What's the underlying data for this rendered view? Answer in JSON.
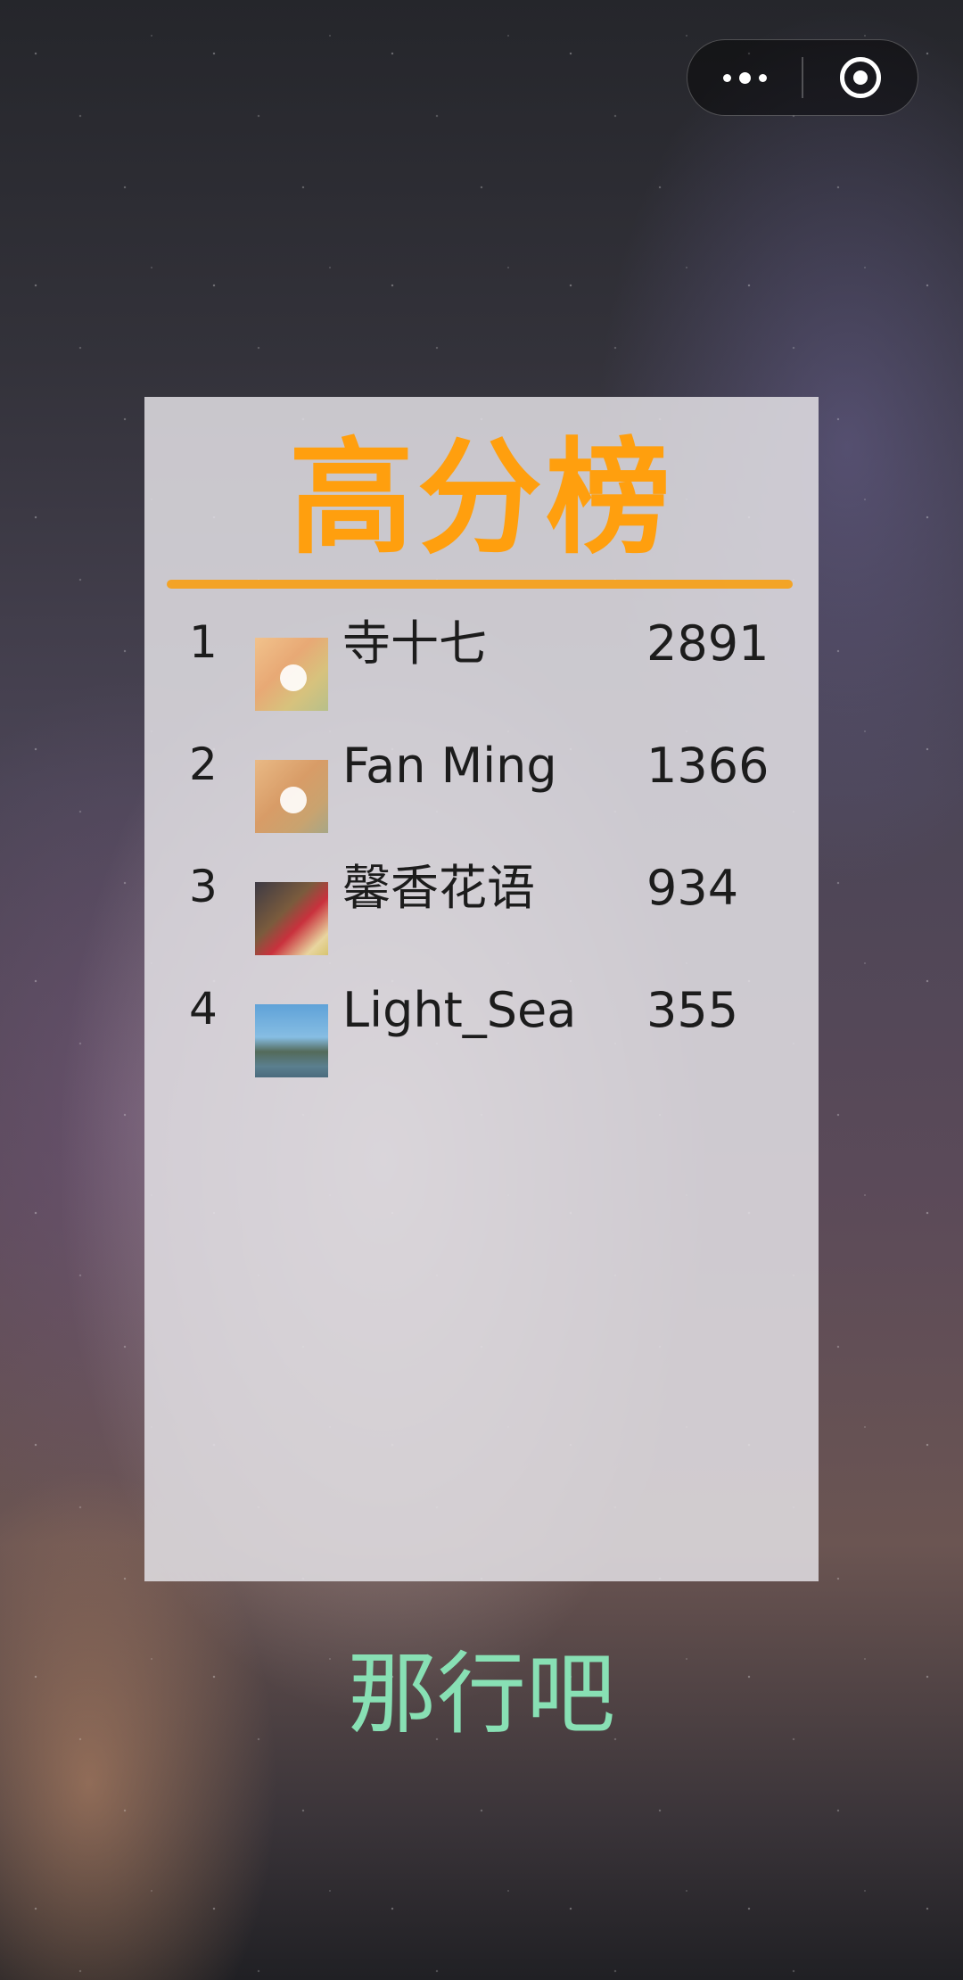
{
  "capsule": {
    "more_icon": "more-dots-icon",
    "close_icon": "target-circle-icon"
  },
  "leaderboard": {
    "title": "高分榜",
    "entries": [
      {
        "rank": "1",
        "avatar": "bear-avatar",
        "name": "寺十七",
        "score": "2891"
      },
      {
        "rank": "2",
        "avatar": "bear-avatar",
        "name": "Fan Ming",
        "score": "1366"
      },
      {
        "rank": "3",
        "avatar": "person-photo-avatar",
        "name": "馨香花语",
        "score": "934"
      },
      {
        "rank": "4",
        "avatar": "landscape-photo-avatar",
        "name": "Light_Sea",
        "score": "355"
      }
    ]
  },
  "footer": {
    "button_label": "那行吧"
  },
  "colors": {
    "title": "#ff9f0e",
    "footer": "#88e0b4",
    "text": "#1c1c1c"
  }
}
